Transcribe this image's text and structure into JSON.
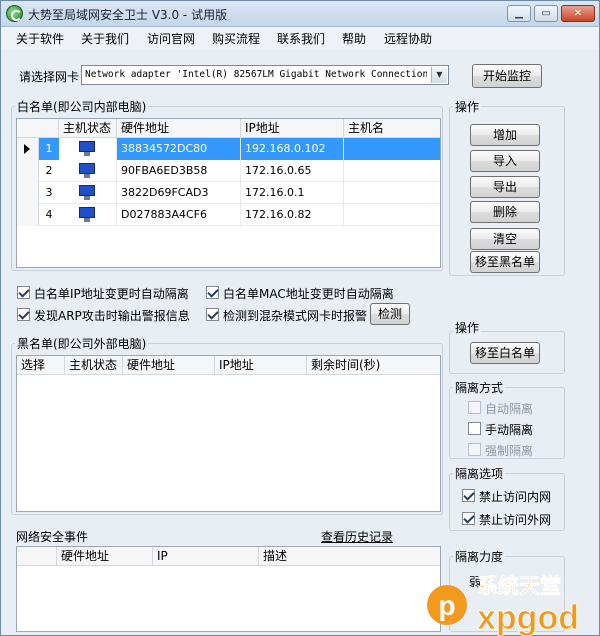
{
  "window": {
    "title": "大势至局域网安全卫士 V3.0 - 试用版",
    "controls": [
      "minimize-icon",
      "maximize-icon",
      "close-icon"
    ]
  },
  "menu": [
    "关于软件",
    "关于我们",
    "访问官网",
    "购买流程",
    "联系我们",
    "帮助",
    "远程协助"
  ],
  "nic": {
    "label": "请选择网卡",
    "selected": "Network adapter 'Intel(R) 82567LM Gigabit Network Connection'",
    "start_button": "开始监控"
  },
  "whitelist": {
    "title": "白名单(即公司内部电脑)",
    "columns": [
      "主机状态",
      "硬件地址",
      "IP地址",
      "主机名"
    ],
    "rows": [
      {
        "no": "1",
        "mac": "38834572DC80",
        "ip": "192.168.0.102",
        "host": ""
      },
      {
        "no": "2",
        "mac": "90FBA6ED3B58",
        "ip": "172.16.0.65",
        "host": ""
      },
      {
        "no": "3",
        "mac": "3822D69FCAD3",
        "ip": "172.16.0.1",
        "host": ""
      },
      {
        "no": "4",
        "mac": "D027883A4CF6",
        "ip": "172.16.0.82",
        "host": ""
      }
    ]
  },
  "ops1": {
    "title": "操作",
    "buttons": [
      "增加",
      "导入",
      "导出",
      "删除",
      "清空",
      "移至黑名单"
    ]
  },
  "options": {
    "ip_change": {
      "label": "白名单IP地址变更时自动隔离",
      "checked": true
    },
    "mac_change": {
      "label": "白名单MAC地址变更时自动隔离",
      "checked": true
    },
    "arp_alert": {
      "label": "发现ARP攻击时输出警报信息",
      "checked": true
    },
    "promisc_alert": {
      "label": "检测到混杂模式网卡时报警",
      "checked": true
    },
    "detect_button": "检测"
  },
  "blacklist": {
    "title": "黑名单(即公司外部电脑)",
    "columns": [
      "选择",
      "主机状态",
      "硬件地址",
      "IP地址",
      "剩余时间(秒)"
    ]
  },
  "ops2": {
    "title": "操作",
    "button": "移至白名单"
  },
  "isolation_mode": {
    "title": "隔离方式",
    "items": [
      {
        "label": "自动隔离",
        "checked": false,
        "enabled": false
      },
      {
        "label": "手动隔离",
        "checked": false,
        "enabled": true
      },
      {
        "label": "强制隔离",
        "checked": false,
        "enabled": false
      }
    ]
  },
  "isolation_options": {
    "title": "隔离选项",
    "items": [
      {
        "label": "禁止访问内网",
        "checked": true
      },
      {
        "label": "禁止访问外网",
        "checked": true
      }
    ]
  },
  "events": {
    "title": "网络安全事件",
    "history_link": "查看历史记录",
    "columns": [
      "硬件地址",
      "IP",
      "描述"
    ]
  },
  "strength": {
    "title": "隔离力度",
    "value": "弱"
  },
  "watermark": {
    "text": "系统天堂",
    "site": "xpgod"
  },
  "colors": {
    "selection": "#3399ff",
    "window_bg": "#e9eef4",
    "watermark_orange": "#f39a1e"
  }
}
